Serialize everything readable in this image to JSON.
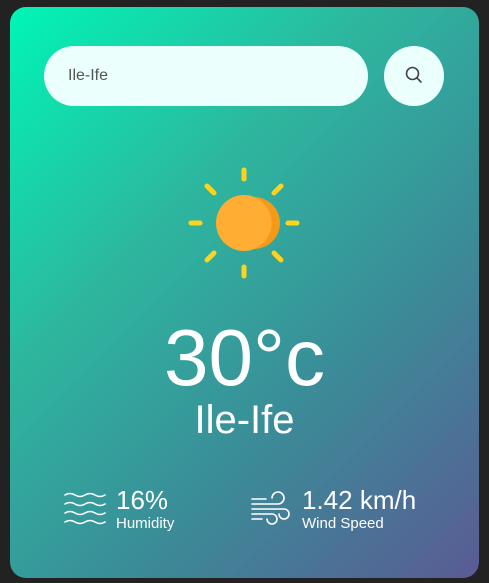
{
  "search": {
    "value": "Ile-Ife",
    "button_icon": "search-icon"
  },
  "weather": {
    "icon": "sun-icon",
    "temperature": "30°c",
    "city": "Ile-Ife"
  },
  "details": {
    "humidity": {
      "icon": "humidity-icon",
      "value": "16%",
      "label": "Humidity"
    },
    "wind": {
      "icon": "wind-icon",
      "value": "1.42 km/h",
      "label": "Wind Speed"
    }
  },
  "colors": {
    "background": "#222222",
    "gradient_start": "#00f5b6",
    "gradient_end": "#5a5b94",
    "input_bg": "#ebfffc",
    "sun_core": "#ffad33",
    "sun_rays": "#ffd21e",
    "text": "#ffffff"
  }
}
